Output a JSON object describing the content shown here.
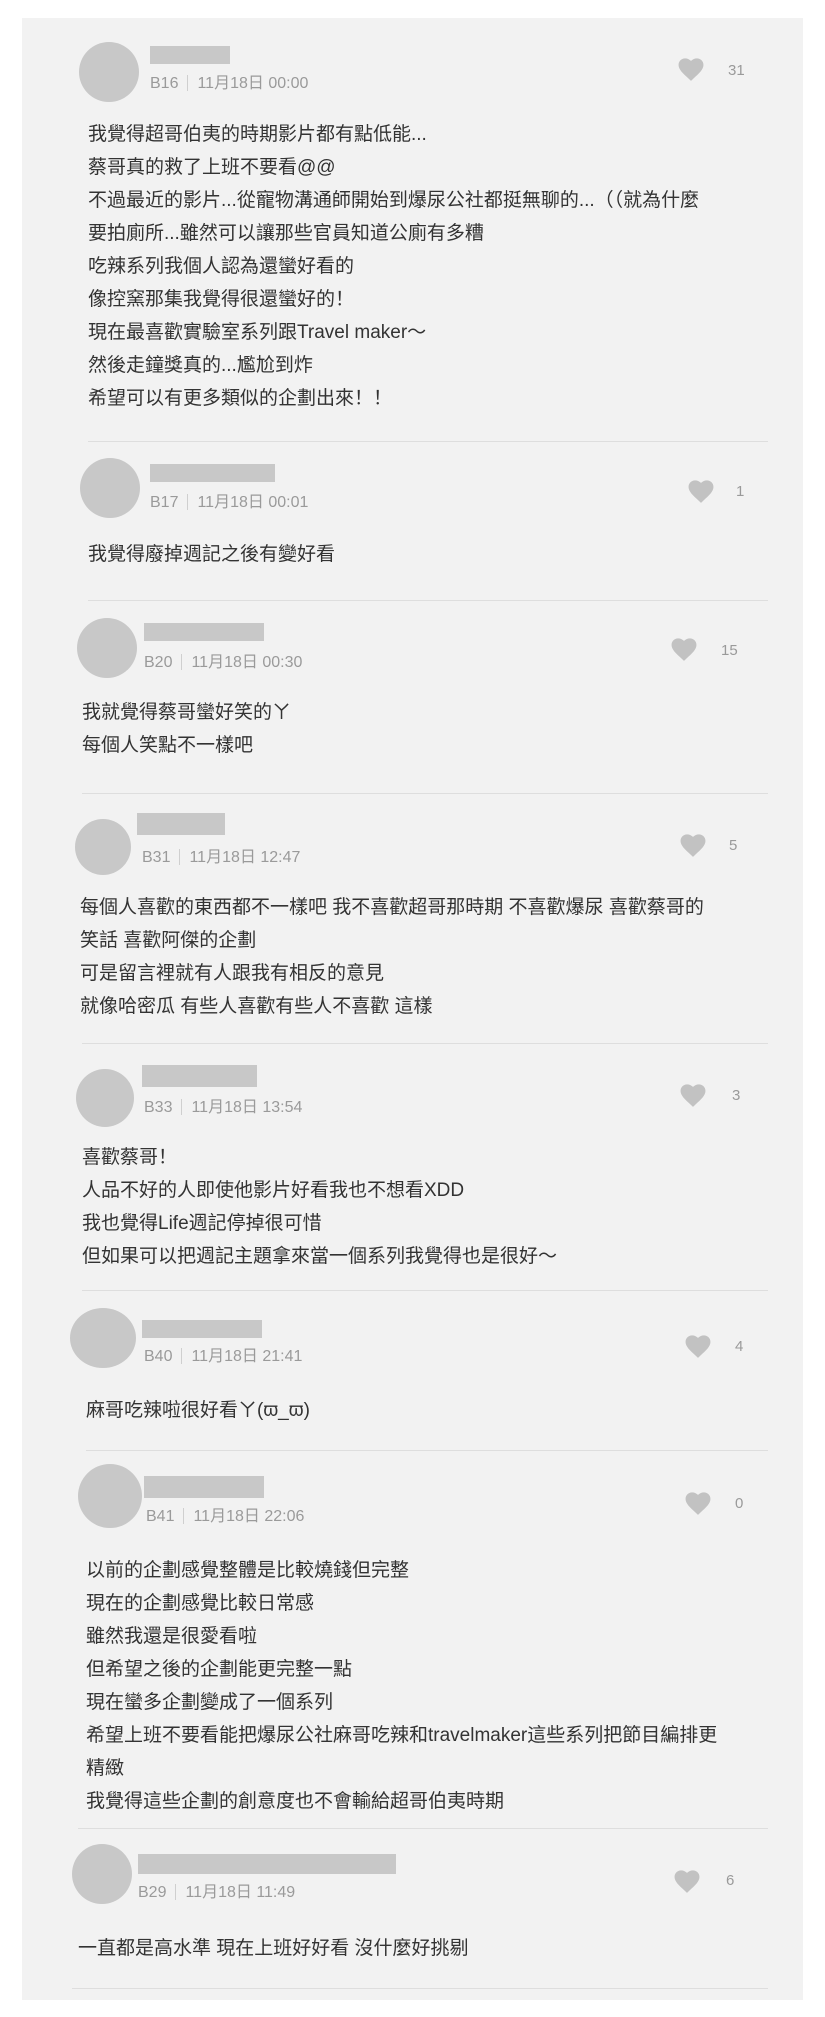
{
  "comments": [
    {
      "floor": "B16",
      "time": "11月18日 00:00",
      "likes": "31",
      "lines": [
        "我覺得超哥伯夷的時期影片都有點低能...",
        "蔡哥真的救了上班不要看@@",
        "不過最近的影片...從寵物溝通師開始到爆尿公社都挺無聊的...（（就為什麼",
        "要拍廁所...雖然可以讓那些官員知道公廁有多糟",
        "吃辣系列我個人認為還蠻好看的",
        "像控窯那集我覺得很還蠻好的！",
        "現在最喜歡實驗室系列跟Travel maker～",
        "然後走鐘獎真的...尷尬到炸",
        "希望可以有更多類似的企劃出來！！"
      ]
    },
    {
      "floor": "B17",
      "time": "11月18日 00:01",
      "likes": "1",
      "lines": [
        "我覺得廢掉週記之後有變好看"
      ]
    },
    {
      "floor": "B20",
      "time": "11月18日 00:30",
      "likes": "15",
      "lines": [
        "我就覺得蔡哥蠻好笑的ㄚ",
        "每個人笑點不一樣吧"
      ]
    },
    {
      "floor": "B31",
      "time": "11月18日 12:47",
      "likes": "5",
      "lines": [
        "每個人喜歡的東西都不一樣吧 我不喜歡超哥那時期 不喜歡爆尿 喜歡蔡哥的",
        "笑話 喜歡阿傑的企劃",
        "可是留言裡就有人跟我有相反的意見",
        "就像哈密瓜 有些人喜歡有些人不喜歡 這樣"
      ]
    },
    {
      "floor": "B33",
      "time": "11月18日 13:54",
      "likes": "3",
      "lines": [
        "喜歡蔡哥！",
        "人品不好的人即使他影片好看我也不想看XDD",
        "我也覺得Life週記停掉很可惜",
        "但如果可以把週記主題拿來當一個系列我覺得也是很好～"
      ]
    },
    {
      "floor": "B40",
      "time": "11月18日 21:41",
      "likes": "4",
      "lines": [
        "麻哥吃辣啦很好看ㄚ(ϖ_ϖ)"
      ]
    },
    {
      "floor": "B41",
      "time": "11月18日 22:06",
      "likes": "0",
      "lines": [
        "以前的企劃感覺整體是比較燒錢但完整",
        "現在的企劃感覺比較日常感",
        "雖然我還是很愛看啦",
        "但希望之後的企劃能更完整一點",
        "現在蠻多企劃變成了一個系列",
        "希望上班不要看能把爆尿公社麻哥吃辣和travelmaker這些系列把節目編排更",
        "精緻",
        "我覺得這些企劃的創意度也不會輸給超哥伯夷時期"
      ]
    },
    {
      "floor": "B29",
      "time": "11月18日 11:49",
      "likes": "6",
      "lines": [
        "一直都是高水準 現在上班好好看 沒什麼好挑剔"
      ]
    }
  ]
}
